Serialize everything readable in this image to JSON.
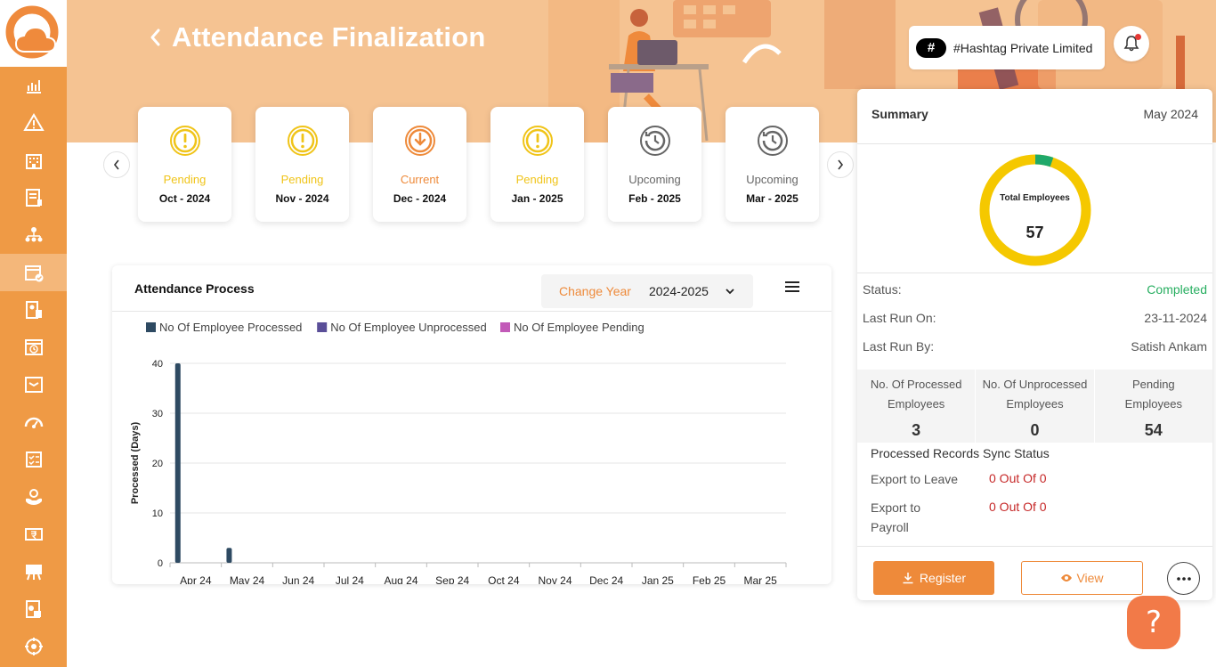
{
  "header": {
    "title": "Attendance Finalization",
    "company_badge": "#",
    "company_name": "#Hashtag Private Limited"
  },
  "colors": {
    "accent": "#ee8a3a",
    "sidebar": "#ef9a45",
    "banner": "#f5c392",
    "pending": "#f0c419",
    "current": "#ee8a3a",
    "upcoming": "#666666",
    "completed": "#27ae60",
    "error": "#c62828"
  },
  "sidebar": {
    "items": [
      {
        "icon": "analytics-icon"
      },
      {
        "icon": "warning-icon"
      },
      {
        "icon": "building-icon"
      },
      {
        "icon": "tax-icon"
      },
      {
        "icon": "org-chart-icon"
      },
      {
        "icon": "attendance-icon",
        "active": true
      },
      {
        "icon": "payslip-icon"
      },
      {
        "icon": "calendar-clock-icon"
      },
      {
        "icon": "approval-icon"
      },
      {
        "icon": "gauge-icon"
      },
      {
        "icon": "checklist-icon"
      },
      {
        "icon": "care-icon"
      },
      {
        "icon": "rupee-icon"
      },
      {
        "icon": "training-icon"
      },
      {
        "icon": "report-icon"
      },
      {
        "icon": "settings-icon"
      }
    ]
  },
  "months": [
    {
      "status": "Pending",
      "label": "Oct - 2024",
      "kind": "pending"
    },
    {
      "status": "Pending",
      "label": "Nov - 2024",
      "kind": "pending"
    },
    {
      "status": "Current",
      "label": "Dec - 2024",
      "kind": "current"
    },
    {
      "status": "Pending",
      "label": "Jan - 2025",
      "kind": "pending"
    },
    {
      "status": "Upcoming",
      "label": "Feb - 2025",
      "kind": "upcoming"
    },
    {
      "status": "Upcoming",
      "label": "Mar - 2025",
      "kind": "upcoming"
    }
  ],
  "attendance_process": {
    "title": "Attendance Process",
    "change_year_label": "Change Year",
    "year_value": "2024-2025"
  },
  "chart_data": {
    "type": "bar",
    "categories": [
      "Apr 24",
      "May 24",
      "Jun 24",
      "Jul 24",
      "Aug 24",
      "Sep 24",
      "Oct 24",
      "Nov 24",
      "Dec 24",
      "Jan 25",
      "Feb 25",
      "Mar 25"
    ],
    "series": [
      {
        "name": "No Of Employee Processed",
        "color": "#2e4a62",
        "values": [
          40,
          3,
          0,
          0,
          0,
          0,
          0,
          0,
          0,
          0,
          0,
          0
        ]
      },
      {
        "name": "No Of Employee Unprocessed",
        "color": "#5a4e98",
        "values": [
          0,
          0,
          0,
          0,
          0,
          0,
          0,
          0,
          0,
          0,
          0,
          0
        ]
      },
      {
        "name": "No Of Employee Pending",
        "color": "#c25ab8",
        "values": [
          0,
          0,
          0,
          0,
          0,
          0,
          0,
          0,
          0,
          0,
          0,
          0
        ]
      }
    ],
    "ylabel": "Processed (Days)",
    "ylim": [
      0,
      40
    ],
    "yticks": [
      0,
      10,
      20,
      30,
      40
    ],
    "grid": true,
    "legend": "top-left"
  },
  "summary": {
    "title": "Summary",
    "month": "May 2024",
    "donut_label": "Total Employees",
    "donut_value": "57",
    "donut_processed": 3,
    "donut_total": 57,
    "status_label": "Status:",
    "status_value": "Completed",
    "last_run_on_label": "Last Run On:",
    "last_run_on_value": "23-11-2024",
    "last_run_by_label": "Last Run By:",
    "last_run_by_value": "Satish Ankam",
    "counts": [
      {
        "line1": "No. Of Processed",
        "line2": "Employees",
        "value": "3"
      },
      {
        "line1": "No. Of Unprocessed",
        "line2": "Employees",
        "value": "0"
      },
      {
        "line1": "Pending",
        "line2": "Employees",
        "value": "54"
      }
    ],
    "sync_title": "Processed Records Sync Status",
    "export_leave_label": "Export to Leave",
    "export_leave_value": "0 Out Of 0",
    "export_payroll_label1": "Export to",
    "export_payroll_label2": "Payroll",
    "export_payroll_value": "0 Out Of 0",
    "register_label": "Register",
    "view_label": "View"
  },
  "help": {
    "label": "?"
  }
}
